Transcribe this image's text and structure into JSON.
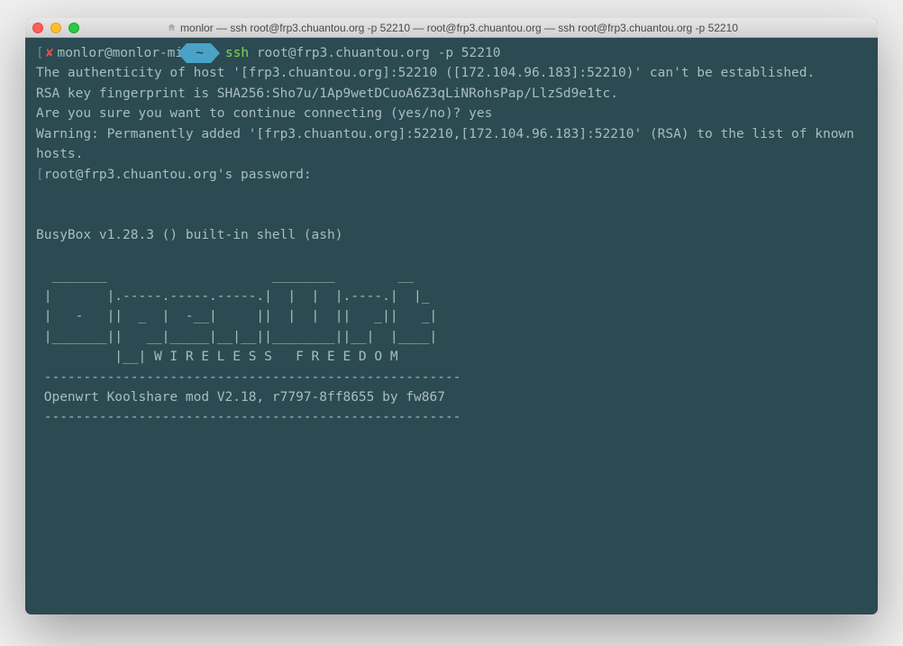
{
  "window": {
    "title": "monlor — ssh root@frp3.chuantou.org -p 52210 — root@frp3.chuantou.org — ssh root@frp3.chuantou.org -p 52210"
  },
  "prompt": {
    "x": "✘",
    "user_host": "monlor@monlor-mi",
    "cwd": "~",
    "cmd": "ssh",
    "args": "root@frp3.chuantou.org -p 52210"
  },
  "output": {
    "l1": "The authenticity of host '[frp3.chuantou.org]:52210 ([172.104.96.183]:52210)' can't be established.",
    "l2": "RSA key fingerprint is SHA256:Sho7u/1Ap9wetDCuoA6Z3qLiNRohsPap/LlzSd9e1tc.",
    "l3": "Are you sure you want to continue connecting (yes/no)? yes",
    "l4": "Warning: Permanently added '[frp3.chuantou.org]:52210,[172.104.96.183]:52210' (RSA) to the list of known hosts.",
    "l5_open": "[",
    "l5": "root@frp3.chuantou.org's password:",
    "busybox": "BusyBox v1.28.3 () built-in shell (ash)",
    "ascii1": "  _______                     ________        __",
    "ascii2": " |       |.-----.-----.-----.|  |  |  |.----.|  |_",
    "ascii3": " |   -   ||  _  |  -__|     ||  |  |  ||   _||   _|",
    "ascii4": " |_______||   __|_____|__|__||________||__|  |____|",
    "ascii5": "          |__| W I R E L E S S   F R E E D O M",
    "div": " -----------------------------------------------------",
    "version": " Openwrt Koolshare mod V2.18, r7797-8ff8655 by fw867",
    "div2": " -----------------------------------------------------"
  }
}
